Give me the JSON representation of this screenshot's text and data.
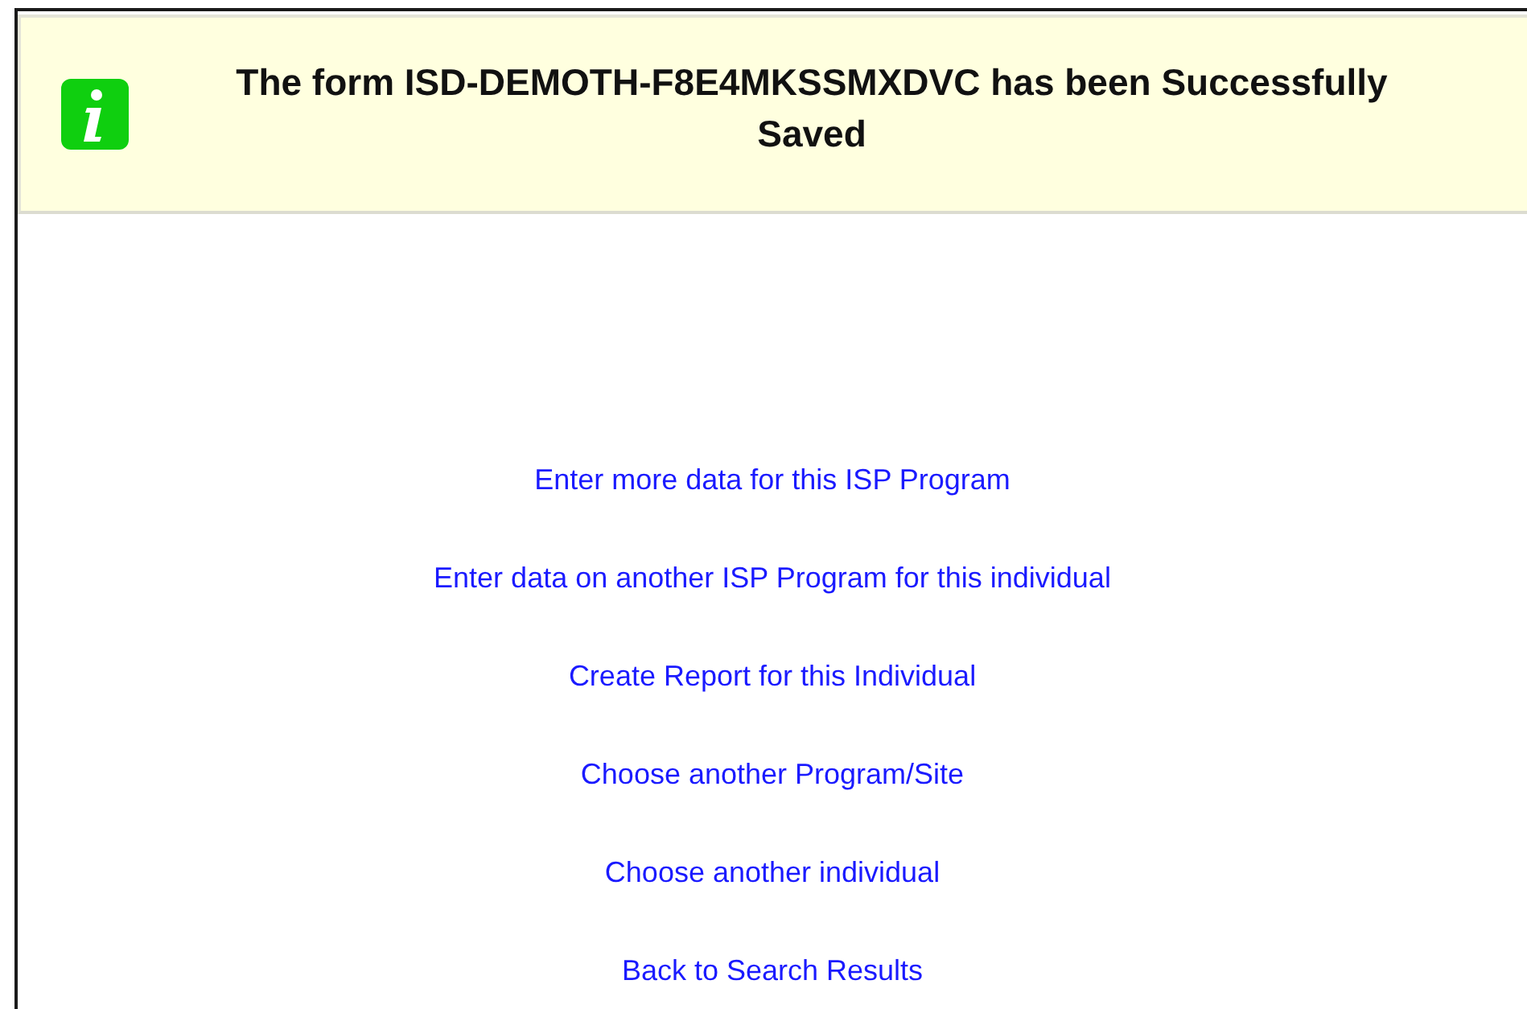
{
  "banner": {
    "kind": "info",
    "message": "The form ISD-DEMOTH-F8E4MKSSMXDVC has been Successfully Saved"
  },
  "links": [
    {
      "label": "Enter more data for this ISP Program"
    },
    {
      "label": "Enter data on another ISP Program for this individual"
    },
    {
      "label": "Create Report for this Individual"
    },
    {
      "label": "Choose another Program/Site"
    },
    {
      "label": "Choose another individual"
    },
    {
      "label": "Back to Search Results"
    }
  ]
}
